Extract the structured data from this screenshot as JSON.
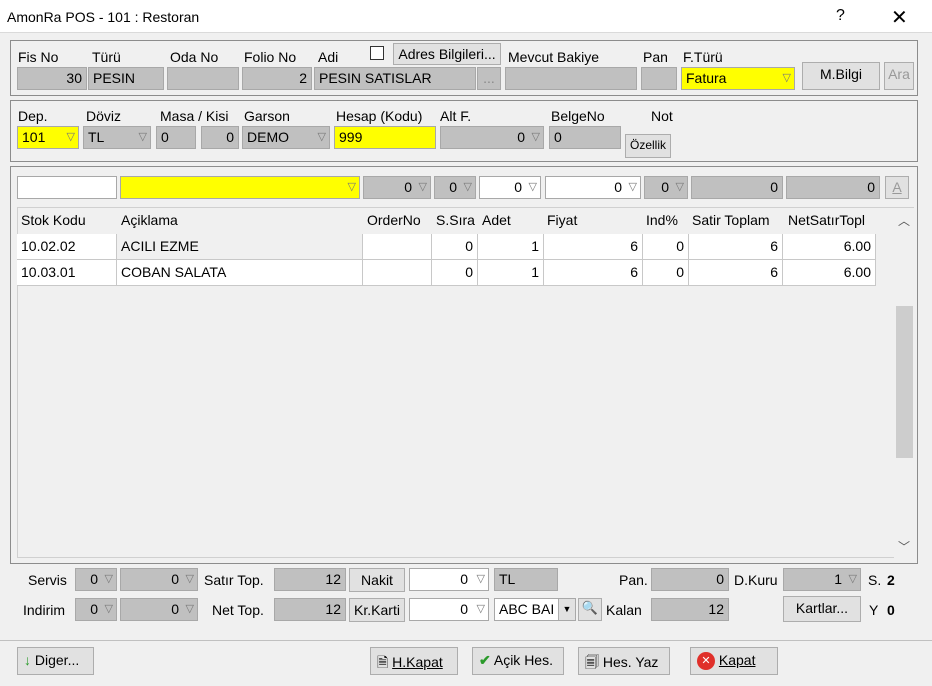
{
  "window": {
    "title": "AmonRa POS - 101 : Restoran",
    "help": "?",
    "close": "✕"
  },
  "top": {
    "fis_no_label": "Fis No",
    "fis_no": "30",
    "turu_label": "Türü",
    "turu": "PESIN",
    "oda_no_label": "Oda No",
    "oda_no": "",
    "folio_no_label": "Folio No",
    "folio_no": "2",
    "adi_label": "Adi",
    "adi": "PESIN SATISLAR",
    "adi_btn": "...",
    "adres_btn": "Adres Bilgileri...",
    "mevcut_label": "Mevcut Bakiye",
    "mevcut": "",
    "pan_label": "Pan",
    "pan": "",
    "fturu_label": "F.Türü",
    "fturu": "Fatura",
    "mbilgi_btn": "M.Bilgi",
    "ara_btn": "Ara"
  },
  "second": {
    "dep_label": "Dep.",
    "dep": "101",
    "doviz_label": "Döviz",
    "doviz": "TL",
    "masa_label": "Masa / Kisi",
    "masa": "0",
    "kisi": "0",
    "garson_label": "Garson",
    "garson": "DEMO",
    "hesap_label": "Hesap (Kodu)",
    "hesap": "999",
    "altf_label": "Alt F.",
    "altf": "0",
    "belge_label": "BelgeNo",
    "belge": "0",
    "not_label": "Not",
    "ozellik_btn": "Özellik"
  },
  "entry": {
    "v1": "0",
    "v2": "0",
    "v3": "0",
    "v4": "0",
    "v5": "0",
    "v6": "0",
    "v7": "0",
    "a_btn": "A"
  },
  "columns": [
    "Stok Kodu",
    "Açiklama",
    "OrderNo",
    "S.Sıra",
    "Adet",
    "Fiyat",
    "Ind%",
    "Satir Toplam",
    "NetSatırTopl"
  ],
  "rows": [
    [
      "10.02.02",
      "ACILI EZME",
      "",
      "0",
      "1",
      "6",
      "0",
      "6",
      "6.00"
    ],
    [
      "10.03.01",
      "COBAN SALATA",
      "",
      "0",
      "1",
      "6",
      "0",
      "6",
      "6.00"
    ]
  ],
  "bottom": {
    "servis_label": "Servis",
    "servis1": "0",
    "servis2": "0",
    "indirim_label": "Indirim",
    "indirim1": "0",
    "indirim2": "0",
    "satir_top_label": "Satır Top.",
    "satir_top": "12",
    "net_top_label": "Net Top.",
    "net_top": "12",
    "nakit_btn": "Nakit",
    "krkarti_btn": "Kr.Karti",
    "nakit_val": "0",
    "kr_val": "0",
    "currency": "TL",
    "bank": "ABC BAI",
    "pan_label": "Pan.",
    "pan_val": "0",
    "kalan_label": "Kalan",
    "kalan_val": "12",
    "dkuru_label": "D.Kuru",
    "dkuru_val": "1",
    "s_label": "S.",
    "s_val": "2",
    "y_label": "Y",
    "y_val": "0",
    "kartlar_btn": "Kartlar..."
  },
  "footer": {
    "diger": "Diger...",
    "hkapat": "H.Kapat",
    "acikhes": "Açik Hes.",
    "hesyaz": "Hes. Yaz",
    "kapat": "Kapat"
  },
  "colors": {
    "yellow": "#ffff00",
    "field_gray": "#c0c0c0"
  }
}
